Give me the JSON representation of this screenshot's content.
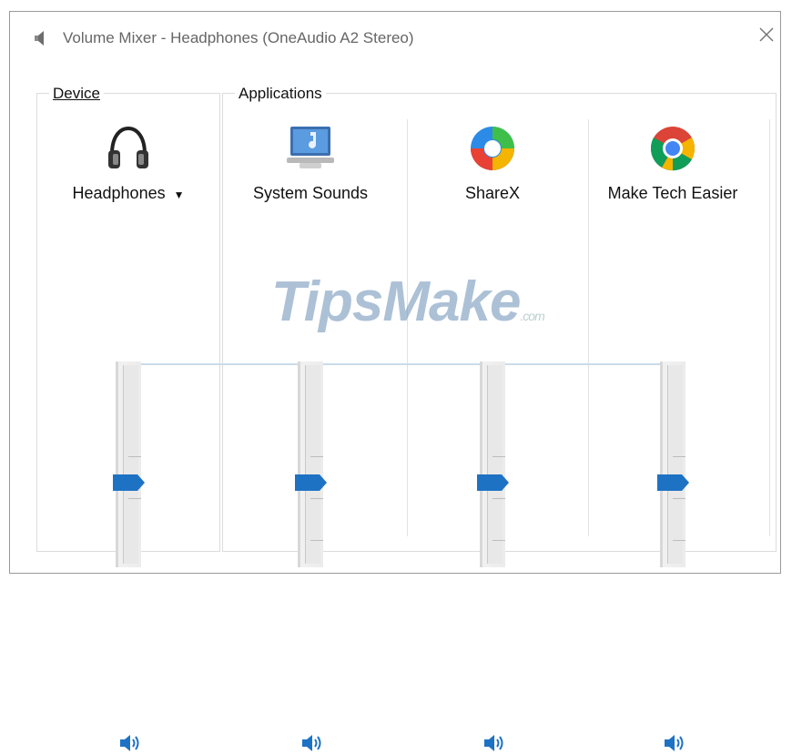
{
  "window": {
    "title": "Volume Mixer - Headphones (OneAudio A2 Stereo)",
    "close_icon": "close-icon"
  },
  "device": {
    "group_label": "Device",
    "name": "Headphones",
    "dropdown_arrow": "▼",
    "icon": "headphones-icon",
    "volume_fraction": 0.45,
    "muted": false
  },
  "applications": {
    "group_label": "Applications",
    "items": [
      {
        "name": "System Sounds",
        "icon": "system-sounds-icon",
        "volume_fraction": 0.45,
        "muted": false
      },
      {
        "name": "ShareX",
        "icon": "sharex-icon",
        "volume_fraction": 0.45,
        "muted": false
      },
      {
        "name": "Make Tech Easier",
        "icon": "chrome-icon",
        "volume_fraction": 0.45,
        "muted": false
      }
    ]
  },
  "watermark": {
    "text": "TipsMake",
    "suffix": ".com"
  },
  "colors": {
    "accent": "#1e72c4",
    "slider_track": "#e8e8e8",
    "link_line": "#c9dcea"
  }
}
